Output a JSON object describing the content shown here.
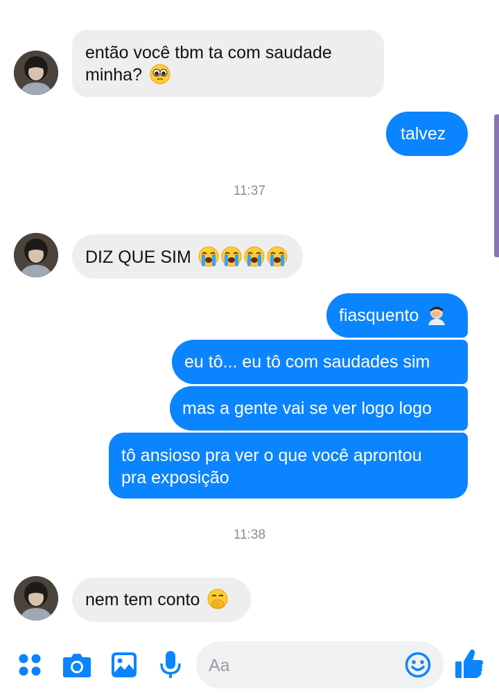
{
  "conversation": {
    "messages": [
      {
        "id": "m1",
        "direction": "in",
        "lines": [
          "então você tbm ta com saudade",
          "minha?"
        ],
        "emoji": "pleading-face"
      },
      {
        "id": "m2",
        "direction": "out",
        "text": "talvez"
      },
      {
        "id": "m3",
        "direction": "in",
        "text": "DIZ QUE SIM",
        "emoji": "loudly-crying-face ×4"
      },
      {
        "id": "m4",
        "direction": "out",
        "text": "fiasquento",
        "emoji": "man-facepalming"
      },
      {
        "id": "m5",
        "direction": "out",
        "text": "eu tô... eu tô com saudades sim"
      },
      {
        "id": "m6",
        "direction": "out",
        "text": "mas a gente vai se ver logo logo"
      },
      {
        "id": "m7",
        "direction": "out",
        "lines": [
          "tô ansioso pra ver o que você aprontou",
          "pra exposição"
        ]
      },
      {
        "id": "m8",
        "direction": "in",
        "text": "nem tem conto",
        "emoji": "face-with-hand-over-mouth"
      }
    ],
    "timestamps": [
      "11:37",
      "11:38"
    ]
  },
  "composer": {
    "placeholder": "Aa",
    "icons": [
      "apps-icon",
      "camera-icon",
      "gallery-icon",
      "microphone-icon",
      "emoji-icon",
      "like-icon"
    ]
  },
  "colors": {
    "outgoing": "#0b84ff",
    "incoming": "#eeeeef",
    "timestamp": "#8a8d91",
    "accent": "#0b84ff"
  }
}
